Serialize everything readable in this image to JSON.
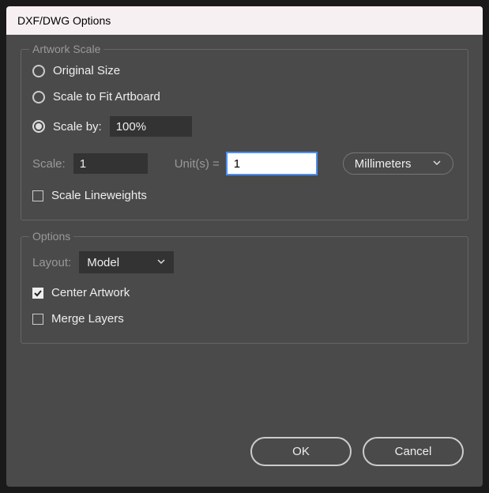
{
  "dialog": {
    "title": "DXF/DWG Options"
  },
  "artwork_scale": {
    "legend": "Artwork Scale",
    "original_size": "Original Size",
    "scale_to_fit": "Scale to Fit Artboard",
    "scale_by_label": "Scale by:",
    "scale_by_value": "100%",
    "scale_label": "Scale:",
    "scale_value": "1",
    "units_label": "Unit(s) =",
    "units_value": "1",
    "unit_select": "Millimeters",
    "scale_lineweights": "Scale Lineweights"
  },
  "options": {
    "legend": "Options",
    "layout_label": "Layout:",
    "layout_value": "Model",
    "center_artwork": "Center Artwork",
    "merge_layers": "Merge Layers"
  },
  "buttons": {
    "ok": "OK",
    "cancel": "Cancel"
  }
}
